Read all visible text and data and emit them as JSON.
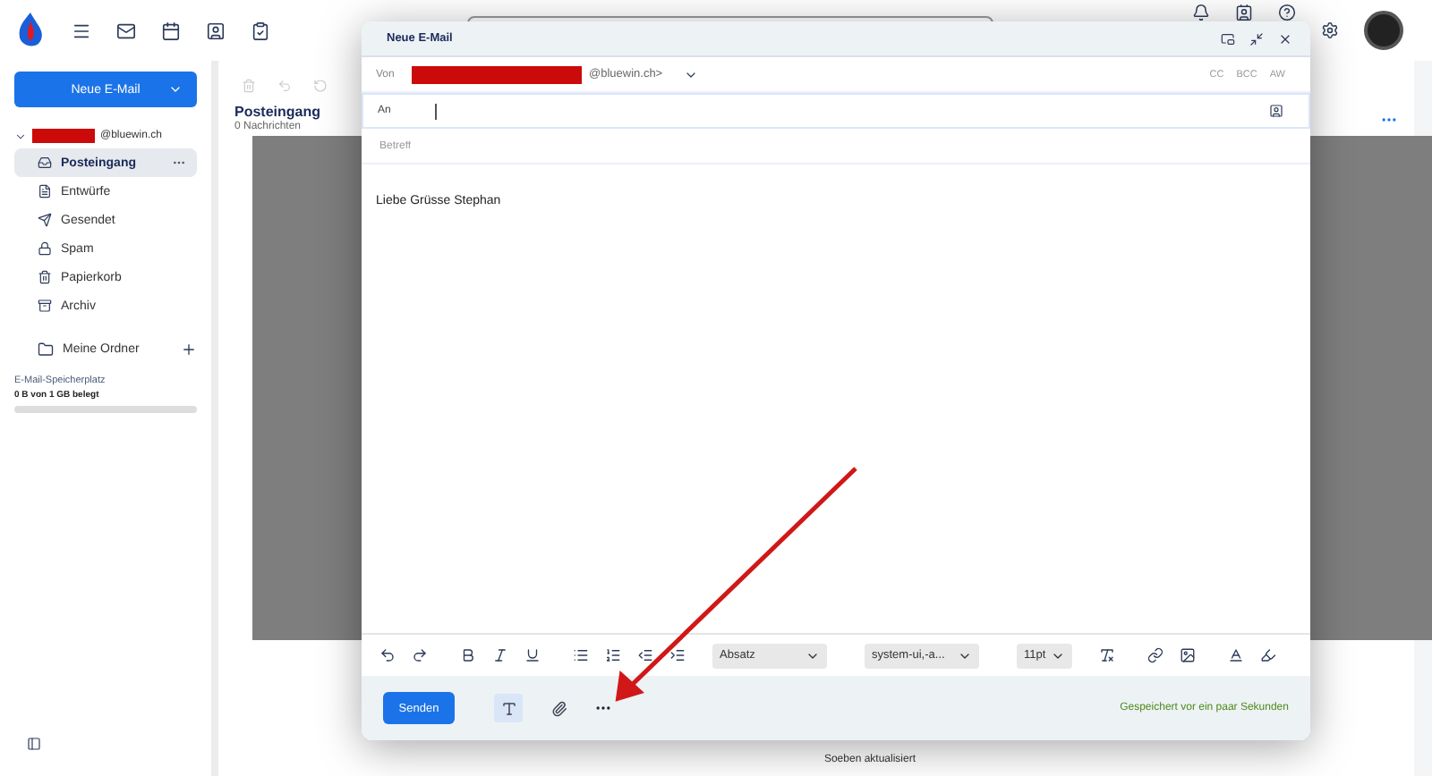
{
  "sidebar": {
    "new_mail_button": "Neue E-Mail",
    "account": "@bluewin.ch",
    "folders": [
      {
        "label": "Posteingang",
        "kind": "inbox",
        "selected": true
      },
      {
        "label": "Entwürfe",
        "kind": "drafts",
        "selected": false
      },
      {
        "label": "Gesendet",
        "kind": "sent",
        "selected": false
      },
      {
        "label": "Spam",
        "kind": "spam",
        "selected": false
      },
      {
        "label": "Papierkorb",
        "kind": "trash",
        "selected": false
      },
      {
        "label": "Archiv",
        "kind": "archive",
        "selected": false
      }
    ],
    "my_folders": "Meine Ordner",
    "storage": {
      "label": "E-Mail-Speicherplatz",
      "usage": "0 B von 1 GB belegt",
      "level": 0
    }
  },
  "mail_list": {
    "title": "Posteingang",
    "count": "0 Nachrichten",
    "status": "Soeben aktualisiert"
  },
  "compose": {
    "title": "Neue E-Mail",
    "from_label": "Von",
    "from_address": "@bluewin.ch>",
    "recipient_options": [
      "CC",
      "BCC",
      "AW"
    ],
    "to_label": "An",
    "subject_placeholder": "Betreff",
    "body": "Liebe Grüsse Stephan",
    "toolbar": {
      "block_format": "Absatz",
      "font": "system-ui,-a...",
      "font_size": "11pt"
    },
    "send_button": "Senden",
    "save_status": "Gespeichert vor ein paar Sekunden"
  }
}
